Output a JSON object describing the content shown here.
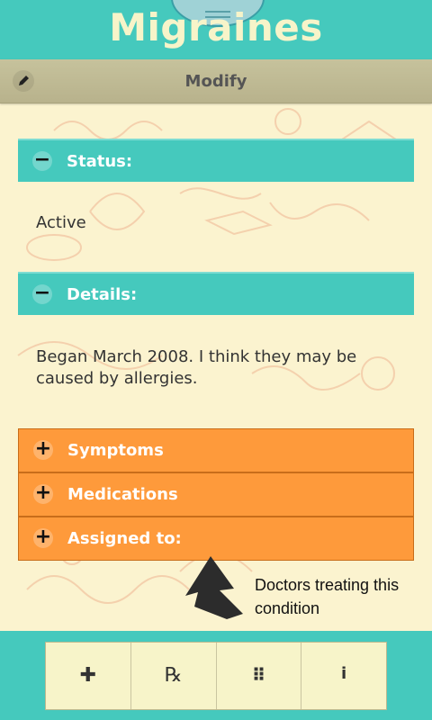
{
  "header": {
    "title": "Migraines"
  },
  "toolbar": {
    "modify_label": "Modify",
    "edit_icon": "pencil-icon"
  },
  "sections": [
    {
      "label": "Status:",
      "state": "expanded",
      "icon": "minus-icon",
      "color": "#45c9bd",
      "content": "Active"
    },
    {
      "label": "Details:",
      "state": "expanded",
      "icon": "minus-icon",
      "color": "#45c9bd",
      "content": "Began March 2008. I think they may be caused by allergies."
    },
    {
      "label": "Symptoms",
      "state": "collapsed",
      "icon": "plus-icon",
      "color": "#fe9a3b"
    },
    {
      "label": "Medications",
      "state": "collapsed",
      "icon": "plus-icon",
      "color": "#fe9a3b"
    },
    {
      "label": "Assigned to:",
      "state": "collapsed",
      "icon": "plus-icon",
      "color": "#fe9a3b"
    }
  ],
  "callout": {
    "text": "Doctors treating this condition"
  },
  "bottom_tabs": [
    {
      "icon": "plus-icon",
      "glyph": "✚"
    },
    {
      "icon": "prescription-icon",
      "glyph": "℞"
    },
    {
      "icon": "grid-icon",
      "glyph": "⠿"
    },
    {
      "icon": "info-icon",
      "glyph": "i"
    }
  ],
  "colors": {
    "primary": "#45c9bd",
    "accent": "#fe9a3b",
    "background": "#fbf3cf",
    "toolbar": "#bdb894"
  }
}
